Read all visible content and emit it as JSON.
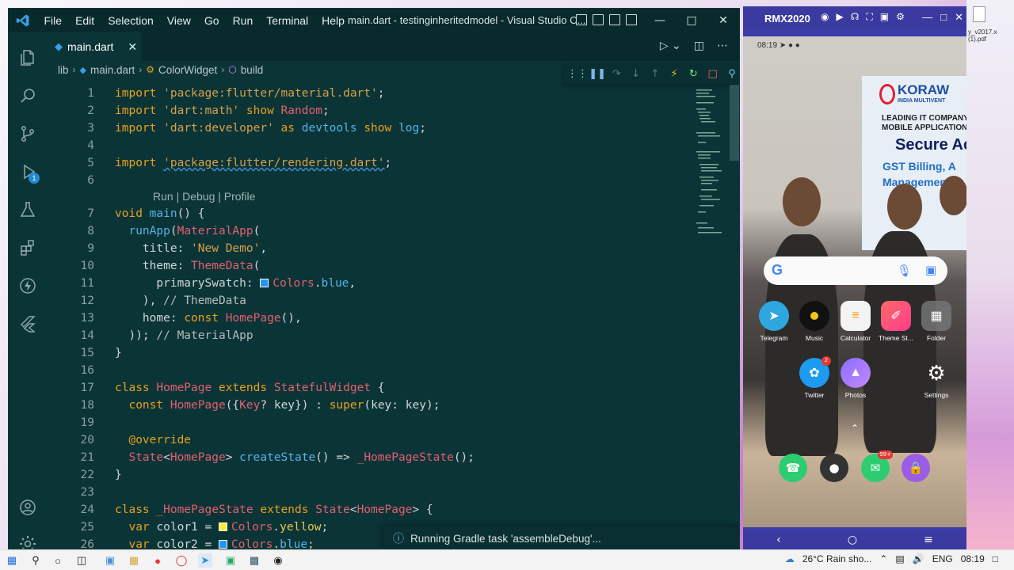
{
  "vscode": {
    "menu": [
      "File",
      "Edit",
      "Selection",
      "View",
      "Go",
      "Run",
      "Terminal",
      "Help"
    ],
    "window_title": "main.dart - testinginheritedmodel - Visual Studio C...",
    "tab_label": "main.dart",
    "breadcrumb": [
      "lib",
      "main.dart",
      "ColorWidget",
      "build"
    ],
    "activity_badge": "1",
    "code_lens": "Run | Debug | Profile",
    "line_numbers": [
      "1",
      "2",
      "3",
      "4",
      "5",
      "6",
      "7",
      "8",
      "9",
      "10",
      "11",
      "12",
      "13",
      "14",
      "15",
      "16",
      "17",
      "18",
      "19",
      "20",
      "21",
      "22",
      "23",
      "24",
      "25",
      "26"
    ],
    "notification": "Running Gradle task 'assembleDebug'..."
  },
  "phone": {
    "window_name": "RMX2020",
    "status_time": "08:19",
    "banner": {
      "brand": "KORAW",
      "tag1": "INDIA MULTIVENT",
      "tag2": "LEADING IT COMPANY",
      "tag3": "MOBILE APPLICATION,",
      "headline": "Secure Ac",
      "line1": "GST Billing, A",
      "line2": "Management"
    },
    "apps_row1": [
      "Telegram",
      "Music",
      "Calculator",
      "Theme St...",
      "Folder"
    ],
    "apps_row2": [
      "Twitter",
      "Photos",
      "Settings"
    ],
    "twitter_badge": "2",
    "messages_badge": "99+"
  },
  "side_text": {
    "line1": "y_v2017.x",
    "line2": "(1).pdf"
  },
  "taskbar": {
    "weather": "26°C  Rain sho...",
    "lang": "ENG",
    "time": "08:19"
  },
  "colors": {
    "editor_bg": "#0b3437",
    "keyword": "#e6a11d",
    "class": "#e2606e",
    "string": "#d6a04a",
    "function": "#57b3e6",
    "phone_frame": "#3a3aa0"
  }
}
